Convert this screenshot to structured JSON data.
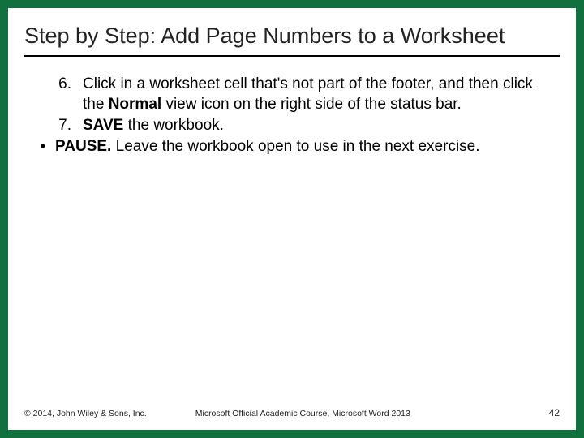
{
  "title": "Step by Step: Add Page Numbers to a Worksheet",
  "steps": [
    {
      "num": "6.",
      "pre": "Click in a worksheet cell that's not part of the footer, and then click the ",
      "bold": "Normal",
      "post": " view icon on the right side of the status bar."
    },
    {
      "num": "7.",
      "pre": " ",
      "bold": "SAVE",
      "post": " the workbook."
    }
  ],
  "bullet": {
    "bold": "PAUSE.",
    "post": " Leave the workbook open to use in the next exercise."
  },
  "footer": {
    "copyright": "© 2014, John Wiley & Sons, Inc.",
    "course": "Microsoft Official Academic Course, Microsoft Word 2013",
    "page": "42"
  }
}
